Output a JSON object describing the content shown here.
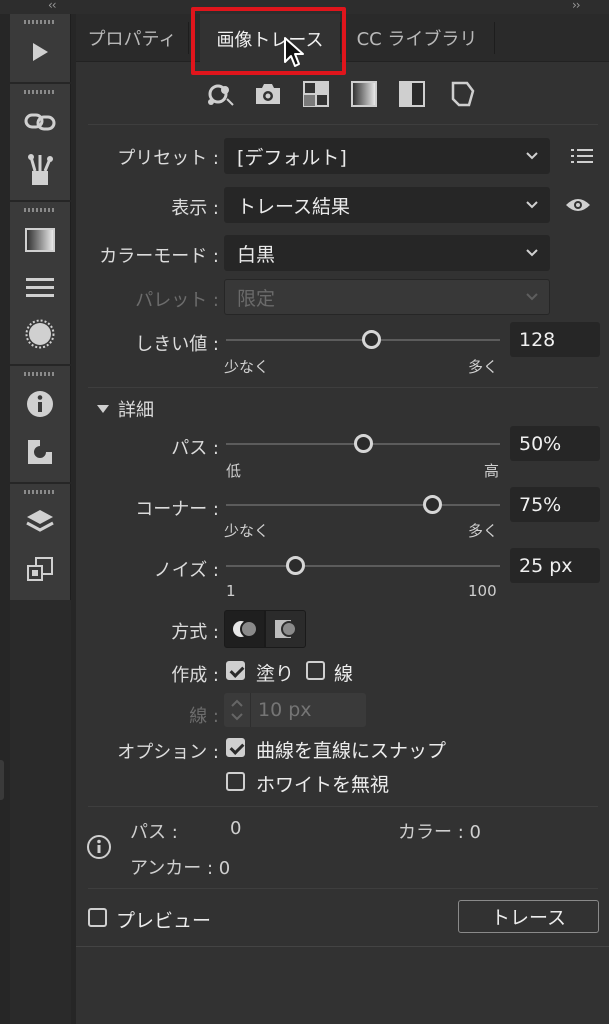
{
  "tabs": [
    {
      "label": "プロパティ",
      "active": false
    },
    {
      "label": "画像トレース",
      "active": true
    },
    {
      "label": "CC ライブラリ",
      "active": false
    }
  ],
  "preset": {
    "label": "プリセット :",
    "value": "[デフォルト]"
  },
  "view": {
    "label": "表示 :",
    "value": "トレース結果"
  },
  "color_mode": {
    "label": "カラーモード :",
    "value": "白黒"
  },
  "palette": {
    "label": "パレット :",
    "value": "限定"
  },
  "threshold": {
    "label": "しきい値 :",
    "value": "128",
    "min_label": "少なく",
    "max_label": "多く",
    "level": 0.53
  },
  "advanced": {
    "label": "詳細"
  },
  "paths": {
    "label": "パス :",
    "value": "50%",
    "min_label": "低",
    "max_label": "高",
    "level": 0.5
  },
  "corners": {
    "label": "コーナー :",
    "value": "75%",
    "min_label": "少なく",
    "max_label": "多く",
    "level": 0.75
  },
  "noise": {
    "label": "ノイズ :",
    "value": "25 px",
    "min_label": "1",
    "max_label": "100",
    "level": 0.25
  },
  "method": {
    "label": "方式 :"
  },
  "create": {
    "label": "作成 :",
    "fill_label": "塗り",
    "fill_checked": true,
    "stroke_label": "線",
    "stroke_checked": false
  },
  "stroke": {
    "label": "線 :",
    "placeholder": "10 px"
  },
  "options": {
    "label": "オプション :",
    "snap_label": "曲線を直線にスナップ",
    "snap_checked": true,
    "ignore_white_label": "ホワイトを無視",
    "ignore_white_checked": false
  },
  "info": {
    "paths_label": "パス :",
    "paths_value": "0",
    "colors_label": "カラー : 0",
    "anchors_label": "アンカー : 0"
  },
  "preview": {
    "label": "プレビュー",
    "checked": false
  },
  "trace_button": "トレース",
  "colors": {
    "highlight": "#e0151c",
    "panel": "#323232",
    "field": "#262626"
  }
}
